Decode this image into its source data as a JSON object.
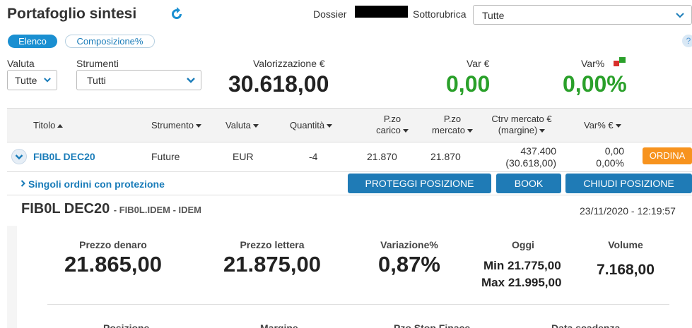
{
  "header": {
    "title": "Portafoglio sintesi",
    "dossier_label": "Dossier",
    "sottorubrica_label": "Sottorubrica",
    "sottorubrica_value": "Tutte"
  },
  "tabs": {
    "elenco": "Elenco",
    "composizione": "Composizione%",
    "help": "?"
  },
  "filters": {
    "valuta_label": "Valuta",
    "valuta_value": "Tutte",
    "strumenti_label": "Strumenti",
    "strumenti_value": "Tutti"
  },
  "summary": {
    "valorizzazione_label": "Valorizzazione €",
    "valorizzazione_value": "30.618,00",
    "var_label": "Var €",
    "var_value": "0,00",
    "varpct_label": "Var%",
    "varpct_value": "0,00%"
  },
  "table": {
    "headers": {
      "titolo": "Titolo",
      "strumento": "Strumento",
      "valuta": "Valuta",
      "quantita": "Quantità",
      "pzo_carico_1": "P.zo",
      "pzo_carico_2": "carico",
      "pzo_mercato_1": "P.zo",
      "pzo_mercato_2": "mercato",
      "ctrv_1": "Ctrv mercato €",
      "ctrv_2": "(margine)",
      "varpct": "Var% €"
    },
    "row": {
      "titolo": "FIB0L DEC20",
      "strumento": "Future",
      "valuta": "EUR",
      "quantita": "-4",
      "pzo_carico": "21.870",
      "pzo_mercato": "21.870",
      "ctrv_1": "437.400",
      "ctrv_2": "(30.618,00)",
      "var_1": "0,00",
      "var_2": "0,00%",
      "ordina": "ORDINA"
    }
  },
  "subrow": {
    "singoli": "Singoli ordini con protezione",
    "proteggi": "PROTEGGI POSIZIONE",
    "book": "BOOK",
    "chiudi": "CHIUDI POSIZIONE"
  },
  "detail": {
    "title": "FIB0L DEC20",
    "subtitle": "- FIB0L.IDEM - IDEM",
    "timestamp": "23/11/2020 - 12:19:57",
    "prezzo_denaro_label": "Prezzo denaro",
    "prezzo_denaro_value": "21.865,00",
    "prezzo_lettera_label": "Prezzo lettera",
    "prezzo_lettera_value": "21.875,00",
    "variazione_label": "Variazione%",
    "variazione_value": "0,87%",
    "oggi_label": "Oggi",
    "min_label": "Min",
    "min_value": "21.775,00",
    "max_label": "Max",
    "max_value": "21.995,00",
    "volume_label": "Volume",
    "volume_value": "7.168,00",
    "bottom_posizione": "Posizione",
    "bottom_margine": "Margine",
    "bottom_stop": "Pzo Stop Finace",
    "bottom_scadenza": "Data scadenza"
  },
  "colors": {
    "accent": "#1a7cb9",
    "positive": "#2aa02a",
    "ordina": "#f7931e",
    "button": "#1f7bb6"
  }
}
